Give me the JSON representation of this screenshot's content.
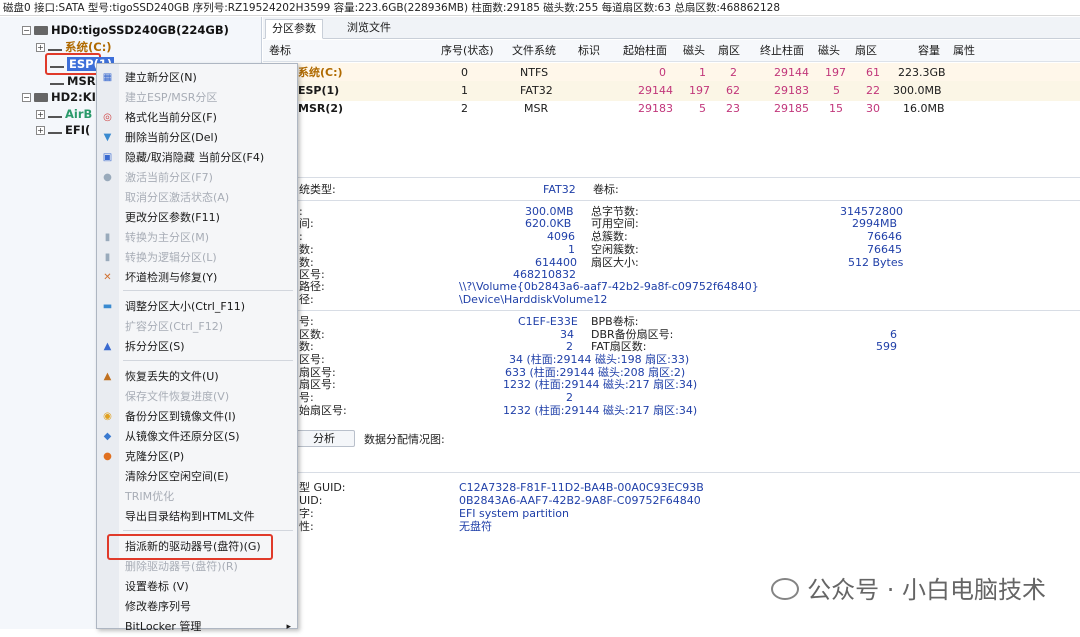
{
  "topbar": {
    "text": "磁盘0 接口:SATA  型号:tigoSSD240GB  序列号:RZ19524202H3599  容量:223.6GB(228936MB)  柱面数:29185  磁头数:255  每道扇区数:63  总扇区数:468862128"
  },
  "tree": {
    "disk0": "HD0:tigoSSD240GB(224GB)",
    "sys": "系统(C:)",
    "esp": "ESP(1)",
    "msr": "MSR(",
    "disk2": "HD2:KI",
    "air": "AirB",
    "efi": "EFI("
  },
  "tabs": [
    "分区参数",
    "浏览文件"
  ],
  "table": {
    "headers": [
      "卷标",
      "序号(状态)",
      "文件系统",
      "标识",
      "起始柱面",
      "磁头",
      "扇区",
      "终止柱面",
      "磁头",
      "扇区",
      "容量",
      "属性"
    ],
    "rows": [
      [
        "系统(C:)",
        "0",
        "NTFS",
        "",
        "0",
        "1",
        "2",
        "29144",
        "197",
        "61",
        "223.3GB",
        ""
      ],
      [
        "ESP(1)",
        "1",
        "FAT32",
        "",
        "29144",
        "197",
        "62",
        "29183",
        "5",
        "22",
        "300.0MB",
        ""
      ],
      [
        "MSR(2)",
        "2",
        "MSR",
        "",
        "29183",
        "5",
        "23",
        "29185",
        "15",
        "30",
        "16.0MB",
        ""
      ]
    ]
  },
  "details": {
    "fs_label": "统类型:",
    "fs_value": "FAT32",
    "vol_label": "卷标:",
    "l1": ":",
    "v1": "300.0MB",
    "r1l": "总字节数:",
    "r1v": "314572800",
    "l2": "间:",
    "v2": "620.0KB",
    "r2l": "可用空间:",
    "r2v": "2994MB",
    "l3": ":",
    "v3": "4096",
    "r3l": "总簇数:",
    "r3v": "76646",
    "l4": "数:",
    "v4": "1",
    "r4l": "空闲簇数:",
    "r4v": "76645",
    "l5": "数:",
    "v5": "614400",
    "r5l": "扇区大小:",
    "r5v": "512 Bytes",
    "l6": "区号:",
    "v6": "468210832",
    "l7": "路径:",
    "v7": "\\\\?\\Volume{0b2843a6-aaf7-42b2-9a8f-c09752f64840}",
    "l8": "径:",
    "v8": "\\Device\\HarddiskVolume12",
    "b1l": "号:",
    "b1v": "C1EF-E33E",
    "b1r": "BPB卷标:",
    "b2l": "区数:",
    "b2v": "34",
    "b2r": "DBR备份扇区号:",
    "b2rv": "6",
    "b3l": "数:",
    "b3v": "2",
    "b3r": "FAT扇区数:",
    "b3rv": "599",
    "b4l": "区号:",
    "b4v": "34 (柱面:29144 磁头:198 扇区:33)",
    "b5l": "扇区号:",
    "b5v": "633 (柱面:29144 磁头:208 扇区:2)",
    "b6l": "扇区号:",
    "b6v": "1232 (柱面:29144 磁头:217 扇区:34)",
    "b7l": "号:",
    "b7v": "2",
    "b8l": "始扇区号:",
    "b8v": "1232 (柱面:29144 磁头:217 扇区:34)",
    "analyze_btn": "分析",
    "alloc_label": "数据分配情况图:",
    "g1l": "型 GUID:",
    "g1v": "C12A7328-F81F-11D2-BA4B-00A0C93EC93B",
    "g2l": "UID:",
    "g2v": "0B2843A6-AAF7-42B2-9A8F-C09752F64840",
    "g3l": "字:",
    "g3v": "EFI system partition",
    "g4l": "性:",
    "g4v": "无盘符"
  },
  "menu": [
    {
      "label": "建立新分区(N)",
      "disabled": false,
      "icon": "new-partition-icon"
    },
    {
      "label": "建立ESP/MSR分区",
      "disabled": true,
      "icon": ""
    },
    {
      "label": "格式化当前分区(F)",
      "disabled": false,
      "icon": "format-icon"
    },
    {
      "label": "删除当前分区(Del)",
      "disabled": false,
      "icon": "delete-icon"
    },
    {
      "label": "隐藏/取消隐藏 当前分区(F4)",
      "disabled": false,
      "icon": "hide-icon"
    },
    {
      "label": "激活当前分区(F7)",
      "disabled": true,
      "icon": "activate-icon"
    },
    {
      "label": "取消分区激活状态(A)",
      "disabled": true,
      "icon": ""
    },
    {
      "label": "更改分区参数(F11)",
      "disabled": false,
      "icon": ""
    },
    {
      "label": "转换为主分区(M)",
      "disabled": true,
      "icon": "convert-primary-icon"
    },
    {
      "label": "转换为逻辑分区(L)",
      "disabled": true,
      "icon": "convert-logical-icon"
    },
    {
      "label": "坏道检测与修复(Y)",
      "disabled": false,
      "icon": "repair-icon"
    },
    {
      "label": "调整分区大小(Ctrl_F11)",
      "disabled": false,
      "icon": "resize-icon"
    },
    {
      "label": "扩容分区(Ctrl_F12)",
      "disabled": true,
      "icon": ""
    },
    {
      "label": "拆分分区(S)",
      "disabled": false,
      "icon": "split-icon"
    },
    {
      "label": "恢复丢失的文件(U)",
      "disabled": false,
      "icon": "recover-icon"
    },
    {
      "label": "保存文件恢复进度(V)",
      "disabled": true,
      "icon": ""
    },
    {
      "label": "备份分区到镜像文件(I)",
      "disabled": false,
      "icon": "backup-icon"
    },
    {
      "label": "从镜像文件还原分区(S)",
      "disabled": false,
      "icon": "restore-icon"
    },
    {
      "label": "克隆分区(P)",
      "disabled": false,
      "icon": "clone-icon"
    },
    {
      "label": "清除分区空闲空间(E)",
      "disabled": false,
      "icon": ""
    },
    {
      "label": "TRIM优化",
      "disabled": true,
      "icon": ""
    },
    {
      "label": "导出目录结构到HTML文件",
      "disabled": false,
      "icon": ""
    },
    {
      "label": "指派新的驱动器号(盘符)(G)",
      "disabled": false,
      "icon": ""
    },
    {
      "label": "删除驱动器号(盘符)(R)",
      "disabled": true,
      "icon": ""
    },
    {
      "label": "设置卷标 (V)",
      "disabled": false,
      "icon": ""
    },
    {
      "label": "修改卷序列号",
      "disabled": false,
      "icon": ""
    },
    {
      "label": "BitLocker 管理",
      "disabled": false,
      "icon": "submenu-arrow-icon"
    }
  ],
  "watermark": "公众号 · 小白电脑技术",
  "colors": {
    "highlight": "#e03a2a",
    "selected": "#3d6fd9",
    "value_blue": "#1f3fa8",
    "value_pink": "#c1367a"
  }
}
